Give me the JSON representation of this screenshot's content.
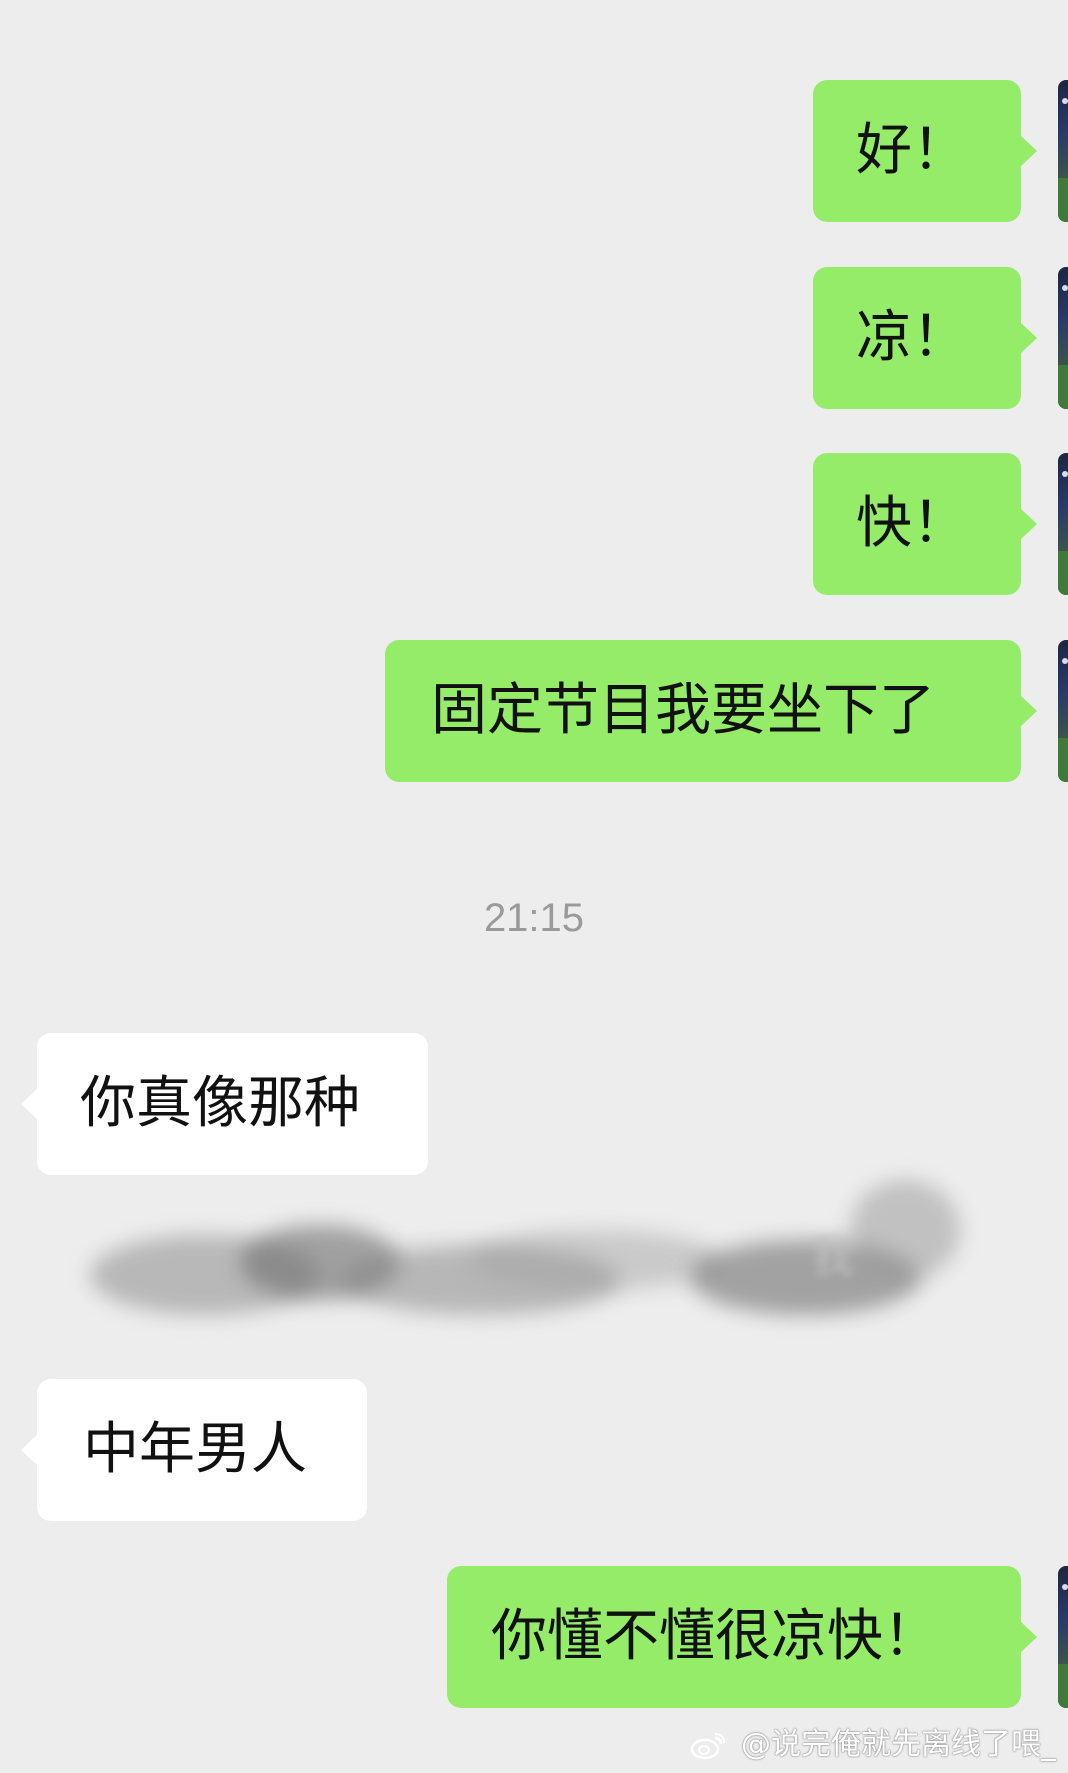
{
  "conversation": {
    "messages": [
      {
        "side": "sent",
        "text": "好！"
      },
      {
        "side": "sent",
        "text": "凉！"
      },
      {
        "side": "sent",
        "text": "快！"
      },
      {
        "side": "sent",
        "text": "固定节目我要坐下了"
      },
      {
        "side": "received",
        "text": "你真像那种"
      },
      {
        "side": "received",
        "text": "中年男人"
      },
      {
        "side": "sent",
        "text": "你懂不懂很凉快！"
      }
    ],
    "timestamp": "21:15",
    "redacted_fragment": "我"
  },
  "watermark": {
    "text": "@说完俺就先离线了喂_"
  },
  "colors": {
    "background": "#ededed",
    "sent_bubble": "#95ec69",
    "received_bubble": "#ffffff"
  }
}
